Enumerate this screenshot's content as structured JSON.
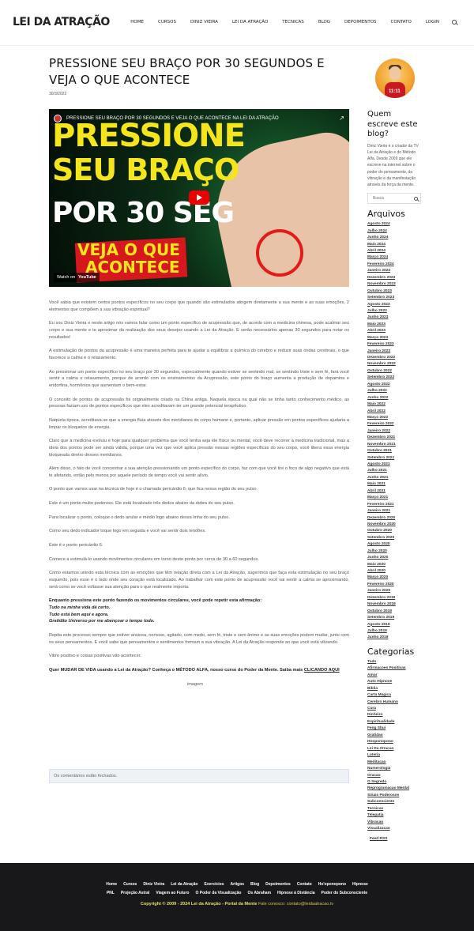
{
  "header": {
    "logo": "LEI DA ATRAÇÃO",
    "logo_emphasis": "ATRAÇÃO",
    "nav": [
      "Home",
      "CURSOS",
      "DINIZ VIEIRA",
      "LEI DA ATRAÇÃO",
      "TECNICAS",
      "BLOG",
      "DEPOIMENTOS",
      "CONTATO",
      "LOGIN"
    ]
  },
  "post": {
    "title": "PRESSIONE SEU BRAÇO POR 30 SEGUNDOS E VEJA O QUE ACONTECE",
    "date": "30/3/2022",
    "video": {
      "title": "PRESSIONE SEU BRAÇO POR 30 SEGUNDOS E VEJA O QUE ACONTECE NA LEI DA ATRAÇÃO",
      "share_label": "Share",
      "thumb_line1": "PRESSIONE",
      "thumb_line2": "SEU BRAÇO",
      "thumb_line3": "POR 30 SEG",
      "thumb_badge1": "VEJA O QUE",
      "thumb_badge2": "ACONTECE",
      "watch_on": "Watch on",
      "youtube": "YouTube"
    },
    "paragraphs": [
      "Você sabia que existem certos pontos específicos no seu corpo que quando são estimulados atingem diretamente a sua mente e as suas emoções, 2 elementos que compõem a sua vibração espiritual?",
      "Eu sou Diniz Vieira e neste artigo nós vamos falar como um ponto específico de acupressão que, de acordo com a medicina chinesa, pode acalmar seu corpo e sua mente e te aproximar da realização dos seus desejos usando a Lei da Atração. E serão necessários apenas 30 segundos para notar os resultados!",
      "A estimulação de pontos da acupressão é uma maneira perfeita para te ajudar a equilibrar a química do cérebro e reduzir suas ondas cerebrais, o que favorece a calma e o relaxamento.",
      "Ao pressionar um ponto específico no seu braço por 30 segundos, especialmente quando estiver se sentindo mal, se sentindo triste e sem fé, fará você sentir a calma e relaxamento, porque de acordo com os ensinamentos da Acupressão, este ponto do braço aumenta a produção de dopamina e endorfina, hormônios que aumentam o bem-estar.",
      "O conceito de pontos de acupressão foi originalmente criado na China antiga. Naquela época na qual não se tinha tanto conhecimento médico, as pessoas faziam uso de pontos específicos que eles acreditavam ter um grande potencial terapêutico.",
      "Naquela época, acreditava-se que a energia fluía através dos meridianos do corpo humano e, portanto, aplicar pressão em pontos específicos ajudaria a limpar os bloqueios de energia.",
      "Claro que a medicina evoluiu e hoje para qualquer problema que você tenha seja ele físico ou mental, você deve recorrer à medicina tradicional, mas a ideia dos pontos pode ser ainda válida, porque uma vez que você aplica pressão nessas regiões específicas do seu corpo, você libera essa energia bloqueada dentro desses meridianos.",
      "Além disso, o fato de você concentrar a sua atenção pressionando um ponto específico do corpo, faz com que você tire o foco de algo negativo que está te afetando, então pelo menos por aquele período de tempo você vai sentir alívio.",
      "O ponto que vamos usar na técnica de hoje é o chamado pericárdio 6, que fica nessa região do seu pulso.",
      "Este é um ponto muito poderoso. Ele está localizado três dedos abaixo da dobra do seu pulso.",
      "Para localizar o ponto, coloque o dedo anular e médio logo abaixo dessa linha do seu pulso.",
      "Como seu dedo indicador toque logo em seguida e você vai sentir dois tendões.",
      "Este é o ponto pericárdio 6.",
      "Comece a estimulá-lo usando movimentos circulares em torno deste ponto por cerca de 30 a 60 segundos.",
      "Como estamos unindo esta técnica com as emoções que têm relação direta com a Lei da Atração, sugerimos que faça esta estimulação no seu braço esquerdo, pois esse é o lado onde seu coração está localizado. Ao trabalhar com este ponto de acupressão você vai sentir a calma se aproximando, será como se você voltasse sua atenção para o que realmente importa."
    ],
    "affirm_intro": "Enquanto pressiona este ponto fazendo os movimentos circulares, você pode repetir esta afirmação:",
    "affirmations": [
      "Tudo na minha vida dá certo.",
      "Tudo está bem aqui e agora.",
      "Gratidão Universo por me abençoar o tempo todo."
    ],
    "after": [
      "Repita este processo sempre que estiver ansiosa, nervoso, agitado, com medo, sem fé, triste e sem ânimo e as suas emoções podem mudar, junto com os seus pensamentos. E você sabe que pensamentos e sentimentos formam a sua vibração. A Lei da Atração responde ao que você está vibrando.",
      "Vibre positivo e coisas positivas vão acontecer."
    ],
    "cta_text": "Quer MUDAR DE VIDA usando a Lei da Atração? Conheça o MÉTODO ALFA, nosso curso do Poder da Mente. Saiba mais",
    "cta_link": "CLICANDO AQUI",
    "image_alt": "imagem",
    "comments_closed": "Os comentários estão fechados."
  },
  "sidebar": {
    "about_heading": "Quem escreve este blog?",
    "about_text": "Diniz Vieira é o criador da TV Lei da Atração e do Método Alfa. Desde 2009 que ele escreve na internet sobre o poder do pensamento, da vibração e da manifestação através da força da mente.",
    "avatar_label": "11:11",
    "search_placeholder": "Busca",
    "archives_heading": "Arquivos",
    "archives": [
      "Agosto 2024",
      "Julho 2024",
      "Junho 2024",
      "Maio 2024",
      "Abril 2024",
      "Março 2024",
      "Fevereiro 2024",
      "Janeiro 2024",
      "Dezembro 2023",
      "Novembro 2023",
      "Outubro 2023",
      "Setembro 2023",
      "Agosto 2023",
      "Julho 2023",
      "Junho 2023",
      "Maio 2023",
      "Abril 2023",
      "Março 2023",
      "Fevereiro 2023",
      "Janeiro 2023",
      "Dezembro 2022",
      "Novembro 2022",
      "Outubro 2022",
      "Setembro 2022",
      "Agosto 2022",
      "Julho 2022",
      "Junho 2022",
      "Maio 2022",
      "Abril 2022",
      "Março 2022",
      "Fevereiro 2022",
      "Janeiro 2022",
      "Dezembro 2021",
      "Novembro 2021",
      "Outubro 2021",
      "Setembro 2021",
      "Agosto 2021",
      "Julho 2021",
      "Junho 2021",
      "Maio 2021",
      "Abril 2021",
      "Março 2021",
      "Fevereiro 2021",
      "Janeiro 2021",
      "Dezembro 2020",
      "Novembro 2020",
      "Outubro 2020",
      "Setembro 2020",
      "Agosto 2020",
      "Julho 2020",
      "Junho 2020",
      "Maio 2020",
      "Abril 2020",
      "Março 2020",
      "Fevereiro 2020",
      "Janeiro 2020",
      "Dezembro 2019",
      "Novembro 2019",
      "Outubro 2019",
      "Setembro 2019",
      "Agosto 2019",
      "Julho 2019",
      "Junho 2019"
    ],
    "categories_heading": "Categorias",
    "categories": [
      "Tudo",
      "Afirmacoes Positivas",
      "Amor",
      "Auto Hipnose",
      "Biblia",
      "Carta Magica",
      "Cerebro Humano",
      "Cura",
      "Dinheiro",
      "Espiritualidade",
      "Feng Shui",
      "Gratidao",
      "Hooponopono",
      "Lei Da Atracao",
      "Loteria",
      "Meditacao",
      "Numerologia",
      "Oracao",
      "O Segredo",
      "Reprogramacao Mental",
      "Sinais Poderosos",
      "Subconsciente",
      "Tecnicas",
      "Telepatia",
      "Vibracao",
      "Visualizacao"
    ],
    "feed": "Feed RSS"
  },
  "footer": {
    "row1": [
      "Home",
      "Cursos",
      "Diniz Vieira",
      "Lei da Atração",
      "Exercícios",
      "Artigos",
      "Blog",
      "Depoimentos",
      "Contato",
      "Ho'oponopono",
      "Hipnose"
    ],
    "row2": [
      "PNL",
      "Projeção Astral",
      "Viagem ao Futuro",
      "O Poder da Visualização",
      "Os Abraham",
      "Hipnose à Distância",
      "Poder do Subconsciente"
    ],
    "copyright": "Copyright © 2009 - 2024 Lei da Atração - Portal da Mente",
    "contact": "Fale conosco: contato@leidaatracao.tv"
  },
  "colors": {
    "accent_red": "#d6171c",
    "thumb_yellow": "#f5e51b",
    "footer_bg": "#18181a",
    "footer_copy": "#e3e35a"
  }
}
